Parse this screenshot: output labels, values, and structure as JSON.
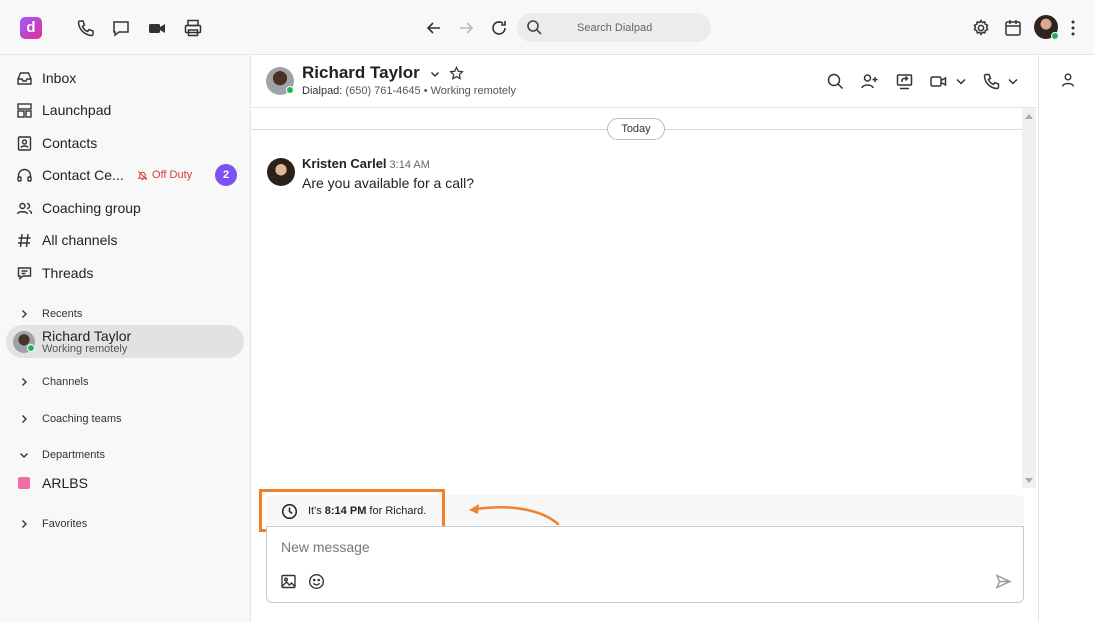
{
  "topbar": {
    "logo_letter": "d",
    "search_placeholder": "Search Dialpad"
  },
  "sidebar": {
    "nav": [
      {
        "label": "Inbox",
        "icon": "inbox-icon"
      },
      {
        "label": "Launchpad",
        "icon": "launchpad-icon"
      },
      {
        "label": "Contacts",
        "icon": "contacts-icon"
      },
      {
        "label": "Contact Ce...",
        "icon": "headset-icon"
      },
      {
        "label": "Coaching group",
        "icon": "users-icon"
      },
      {
        "label": "All channels",
        "icon": "hash-icon"
      },
      {
        "label": "Threads",
        "icon": "threads-icon"
      }
    ],
    "off_duty": "Off Duty",
    "contact_center_badge": "2",
    "recents_label": "Recents",
    "recent_item": {
      "name": "Richard Taylor",
      "status": "Working remotely"
    },
    "channels_label": "Channels",
    "coaching_teams_label": "Coaching teams",
    "departments_label": "Departments",
    "department_item": "ARLBS",
    "favorites_label": "Favorites"
  },
  "chat": {
    "contact_name": "Richard Taylor",
    "contact_line_prefix": "Dialpad:",
    "contact_line_rest": "(650) 761-4645 • Working remotely",
    "day_divider": "Today",
    "message": {
      "author": "Kristen Carlel",
      "time": "3:14 AM",
      "text": "Are you available for a call?"
    },
    "timezone_note": {
      "prefix": "It's",
      "time": "8:14 PM",
      "suffix": "for Richard."
    },
    "composer_placeholder": "New message"
  },
  "colors": {
    "accent_purple": "#7c52f4",
    "off_duty_red": "#d43b3b",
    "presence_green": "#1fb45a",
    "annotation_orange": "#f0822e"
  }
}
